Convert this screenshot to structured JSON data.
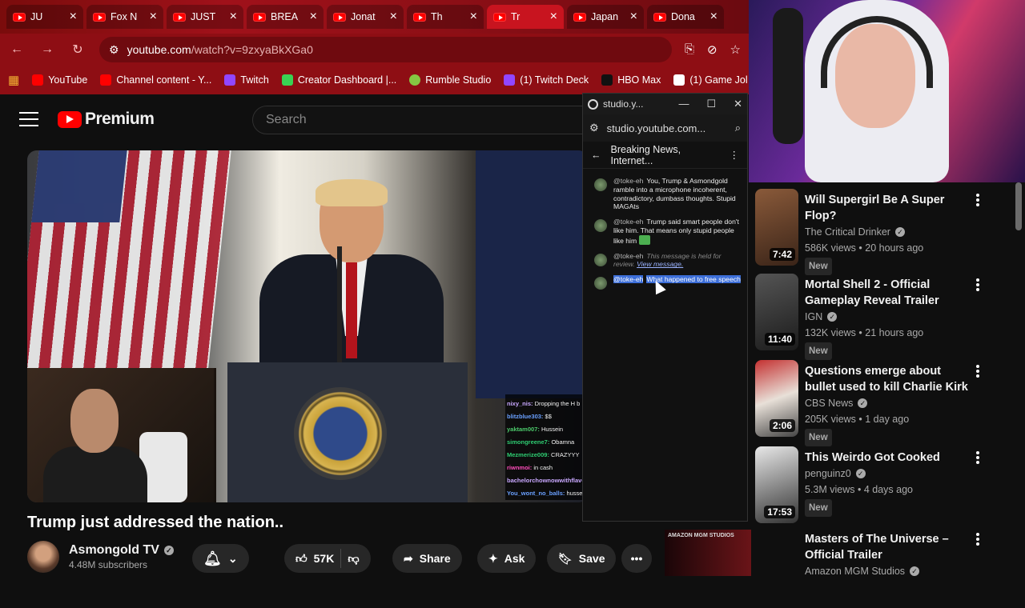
{
  "tabs": [
    {
      "label": "JU",
      "active": false
    },
    {
      "label": "Fox N",
      "active": false
    },
    {
      "label": "JUST",
      "active": false
    },
    {
      "label": "BREA",
      "active": false
    },
    {
      "label": "Jonat",
      "active": false
    },
    {
      "label": "Th",
      "active": false
    },
    {
      "label": "Tr",
      "active": true
    },
    {
      "label": "Japan",
      "active": false
    },
    {
      "label": "Dona",
      "active": false
    }
  ],
  "address": {
    "url_host": "youtube.com",
    "url_path": "/watch?v=9zxyaBkXGa0"
  },
  "bookmarks": [
    {
      "label": "YouTube",
      "color": "#ff0000"
    },
    {
      "label": "Channel content - Y...",
      "color": "#ff0000"
    },
    {
      "label": "Twitch",
      "color": "#9146ff"
    },
    {
      "label": "Creator Dashboard |...",
      "color": "#39d353"
    },
    {
      "label": "Rumble Studio",
      "color": "#85c742"
    },
    {
      "label": "(1) Twitch Deck",
      "color": "#9146ff"
    },
    {
      "label": "HBO Max",
      "color": "#000000"
    },
    {
      "label": "(1) Game Jol",
      "color": "#ffffff"
    }
  ],
  "youtube": {
    "logo_text": "Premium",
    "search_placeholder": "Search",
    "video_title": "Trump just addressed the nation..",
    "channel_name": "Asmongold TV",
    "subscribers": "4.48M subscribers",
    "like_count": "57K",
    "share_label": "Share",
    "ask_label": "Ask",
    "save_label": "Save"
  },
  "twitch_chat": [
    {
      "user": "nixy_nis:",
      "text": "Dropping the H b",
      "color": "#c9a8ff"
    },
    {
      "user": "blitzblue303:",
      "text": "$$",
      "color": "#6aa0ff"
    },
    {
      "user": "yaktam007:",
      "text": "Hussein",
      "color": "#4ccb6b"
    },
    {
      "user": "simongreene7:",
      "text": "Obamna",
      "color": "#2ecc71"
    },
    {
      "user": "Mezmerize009:",
      "text": "CRAZYYY",
      "color": "#2ecc71"
    },
    {
      "user": "riwnmoi:",
      "text": "in cash",
      "color": "#ff4dbb"
    },
    {
      "user": "bachelorchownowwithflavor",
      "text": "",
      "color": "#c9a8ff"
    },
    {
      "user": "You_wont_no_balls:",
      "text": "hussei",
      "color": "#6aa0ff"
    }
  ],
  "popup": {
    "window_title": "studio.y...",
    "url": "studio.youtube.com...",
    "header": "Breaking News, Internet...",
    "messages": [
      {
        "author": "@toke-eh",
        "text": "You, Trump & Asmondgold ramble into a microphone incoherent, contradictory, dumbass thoughts. Stupid MAGAts"
      },
      {
        "author": "@toke-eh",
        "text": "Trump said smart people don't like him. That means only stupid people like him"
      },
      {
        "author": "@toke-eh",
        "held_text": "This message is held for review.",
        "link": "View message."
      },
      {
        "author": "@toke-eh",
        "text": "What happened to free speech"
      }
    ]
  },
  "recommendations": [
    {
      "title": "Will Supergirl Be A Super Flop?",
      "channel": "The Critical Drinker",
      "meta": "586K views • 20 hours ago",
      "badge": "New",
      "duration": "7:42"
    },
    {
      "title": "Mortal Shell 2 - Official Gameplay Reveal Trailer",
      "channel": "IGN",
      "meta": "132K views • 21 hours ago",
      "badge": "New",
      "duration": "11:40"
    },
    {
      "title": "Questions emerge about bullet used to kill Charlie Kirk",
      "channel": "CBS News",
      "meta": "205K views • 1 day ago",
      "badge": "New",
      "duration": "2:06"
    },
    {
      "title": "This Weirdo Got Cooked",
      "channel": "penguinz0",
      "meta": "5.3M views • 4 days ago",
      "badge": "New",
      "duration": "17:53"
    },
    {
      "title": "Masters of The Universe – Official Trailer",
      "channel": "Amazon MGM Studios",
      "meta": "",
      "badge": "",
      "duration": ""
    }
  ],
  "ad_label": "AMAZON MGM STUDIOS"
}
